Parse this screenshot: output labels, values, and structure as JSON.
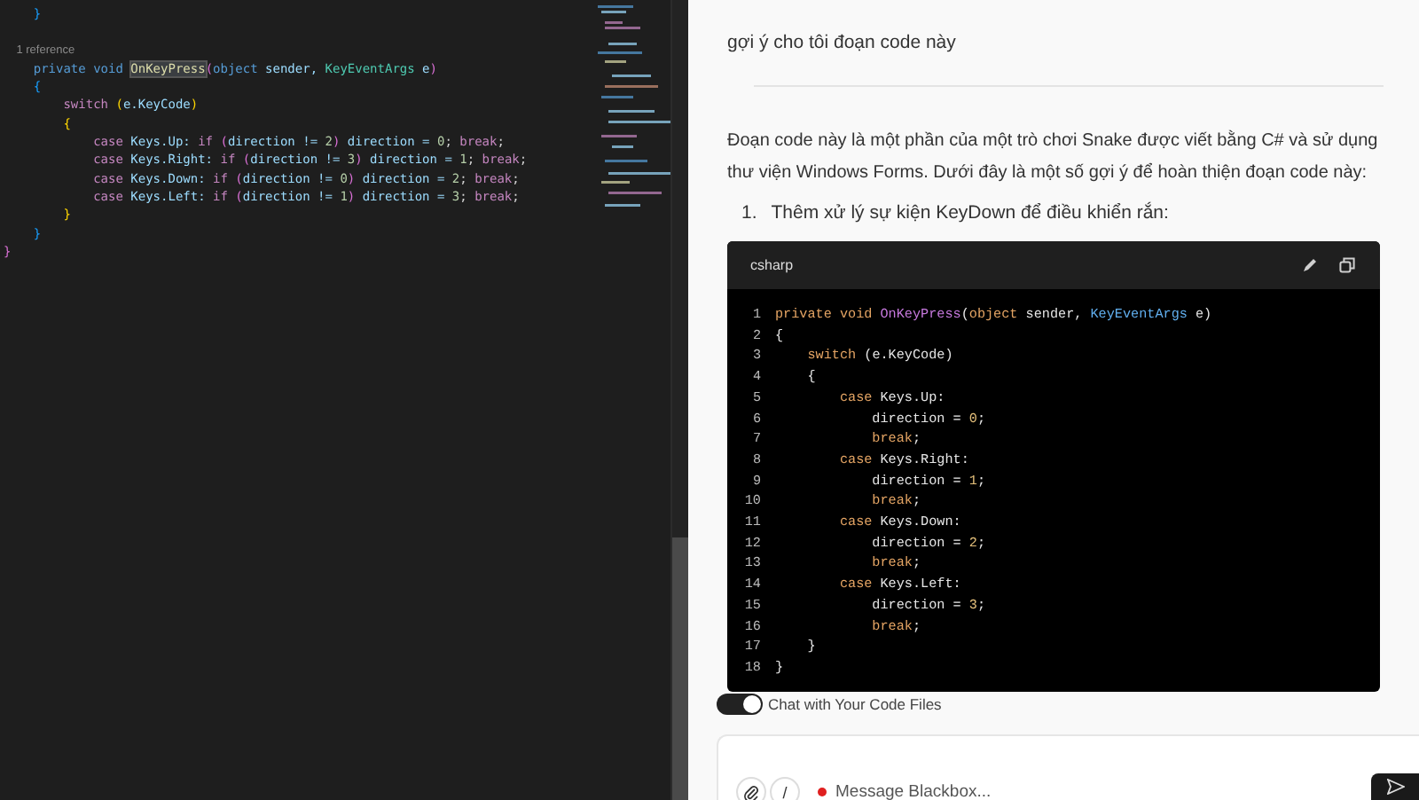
{
  "editor": {
    "lines": [
      {
        "kind": "code",
        "tokens": [
          {
            "text": "    }",
            "kind": "br2"
          }
        ]
      },
      {
        "kind": "lens",
        "tokens": [
          {
            "text": "    1 reference",
            "kind": "lens"
          }
        ]
      },
      {
        "kind": "code",
        "tokens": [
          {
            "text": "    private void ",
            "kind": "kw"
          },
          {
            "text": "OnKeyPress",
            "kind": "fn-hl"
          },
          {
            "text": "(",
            "kind": "br3"
          },
          {
            "text": "object",
            "kind": "kw"
          },
          {
            "text": " sender, ",
            "kind": "var"
          },
          {
            "text": "KeyEventArgs",
            "kind": "type"
          },
          {
            "text": " e",
            "kind": "var"
          },
          {
            "text": ")",
            "kind": "br3"
          }
        ]
      },
      {
        "kind": "code",
        "tokens": [
          {
            "text": "    {",
            "kind": "br2"
          }
        ]
      },
      {
        "kind": "code",
        "tokens": [
          {
            "text": "        switch ",
            "kind": "ctl"
          },
          {
            "text": "(",
            "kind": "br1"
          },
          {
            "text": "e.KeyCode",
            "kind": "var"
          },
          {
            "text": ")",
            "kind": "br1"
          }
        ]
      },
      {
        "kind": "code",
        "tokens": [
          {
            "text": "        {",
            "kind": "br1"
          }
        ]
      },
      {
        "kind": "code",
        "tokens": [
          {
            "text": "            case",
            "kind": "ctl"
          },
          {
            "text": " Keys.Up: ",
            "kind": "var"
          },
          {
            "text": "if ",
            "kind": "ctl"
          },
          {
            "text": "(",
            "kind": "br3"
          },
          {
            "text": "direction != ",
            "kind": "var"
          },
          {
            "text": "2",
            "kind": "num"
          },
          {
            "text": ")",
            "kind": "br3"
          },
          {
            "text": " direction = ",
            "kind": "var"
          },
          {
            "text": "0",
            "kind": "num"
          },
          {
            "text": "; ",
            "kind": "p"
          },
          {
            "text": "break",
            "kind": "ctl"
          },
          {
            "text": ";",
            "kind": "p"
          }
        ]
      },
      {
        "kind": "code",
        "tokens": [
          {
            "text": "            case",
            "kind": "ctl"
          },
          {
            "text": " Keys.Right: ",
            "kind": "var"
          },
          {
            "text": "if ",
            "kind": "ctl"
          },
          {
            "text": "(",
            "kind": "br3"
          },
          {
            "text": "direction != ",
            "kind": "var"
          },
          {
            "text": "3",
            "kind": "num"
          },
          {
            "text": ")",
            "kind": "br3"
          },
          {
            "text": " direction = ",
            "kind": "var"
          },
          {
            "text": "1",
            "kind": "num"
          },
          {
            "text": "; ",
            "kind": "p"
          },
          {
            "text": "break",
            "kind": "ctl"
          },
          {
            "text": ";",
            "kind": "p"
          }
        ]
      },
      {
        "kind": "code",
        "tokens": [
          {
            "text": "            case",
            "kind": "ctl"
          },
          {
            "text": " Keys.Down: ",
            "kind": "var"
          },
          {
            "text": "if ",
            "kind": "ctl"
          },
          {
            "text": "(",
            "kind": "br3"
          },
          {
            "text": "direction != ",
            "kind": "var"
          },
          {
            "text": "0",
            "kind": "num"
          },
          {
            "text": ")",
            "kind": "br3"
          },
          {
            "text": " direction = ",
            "kind": "var"
          },
          {
            "text": "2",
            "kind": "num"
          },
          {
            "text": "; ",
            "kind": "p"
          },
          {
            "text": "break",
            "kind": "ctl"
          },
          {
            "text": ";",
            "kind": "p"
          }
        ]
      },
      {
        "kind": "code",
        "tokens": [
          {
            "text": "            case",
            "kind": "ctl"
          },
          {
            "text": " Keys.Left: ",
            "kind": "var"
          },
          {
            "text": "if ",
            "kind": "ctl"
          },
          {
            "text": "(",
            "kind": "br3"
          },
          {
            "text": "direction != ",
            "kind": "var"
          },
          {
            "text": "1",
            "kind": "num"
          },
          {
            "text": ")",
            "kind": "br3"
          },
          {
            "text": " direction = ",
            "kind": "var"
          },
          {
            "text": "3",
            "kind": "num"
          },
          {
            "text": "; ",
            "kind": "p"
          },
          {
            "text": "break",
            "kind": "ctl"
          },
          {
            "text": ";",
            "kind": "p"
          }
        ]
      },
      {
        "kind": "code",
        "tokens": [
          {
            "text": "        }",
            "kind": "br1"
          }
        ]
      },
      {
        "kind": "code",
        "tokens": [
          {
            "text": "    }",
            "kind": "br2"
          }
        ]
      },
      {
        "kind": "code",
        "tokens": [
          {
            "text": "}",
            "kind": "br3"
          }
        ]
      }
    ]
  },
  "chat": {
    "user_message": "gợi ý cho tôi đoạn code này",
    "answer_paragraph": "Đoạn code này là một phần của một trò chơi Snake được viết bằng C# và sử dụng thư viện Windows Forms. Dưới đây là một số gợi ý để hoàn thiện đoạn code này:",
    "list_items": [
      {
        "number": "1.",
        "text": "Thêm xử lý sự kiện KeyDown để điều khiển rắn:"
      }
    ],
    "code_block": {
      "language": "csharp",
      "lines": [
        {
          "n": "1",
          "tokens": [
            {
              "text": "private void ",
              "kind": "kw"
            },
            {
              "text": "OnKeyPress",
              "kind": "fn"
            },
            {
              "text": "(",
              "kind": "p"
            },
            {
              "text": "object",
              "kind": "kw"
            },
            {
              "text": " sender, ",
              "kind": "p"
            },
            {
              "text": "KeyEventArgs",
              "kind": "type"
            },
            {
              "text": " e)",
              "kind": "p"
            }
          ]
        },
        {
          "n": "2",
          "tokens": [
            {
              "text": "{",
              "kind": "p"
            }
          ]
        },
        {
          "n": "3",
          "tokens": [
            {
              "text": "    switch",
              "kind": "kw"
            },
            {
              "text": " (e.KeyCode)",
              "kind": "p"
            }
          ]
        },
        {
          "n": "4",
          "tokens": [
            {
              "text": "    {",
              "kind": "p"
            }
          ]
        },
        {
          "n": "5",
          "tokens": [
            {
              "text": "        case",
              "kind": "kw"
            },
            {
              "text": " Keys.Up:",
              "kind": "p"
            }
          ]
        },
        {
          "n": "6",
          "tokens": [
            {
              "text": "            direction = ",
              "kind": "p"
            },
            {
              "text": "0",
              "kind": "num"
            },
            {
              "text": ";",
              "kind": "p"
            }
          ]
        },
        {
          "n": "7",
          "tokens": [
            {
              "text": "            break",
              "kind": "kw"
            },
            {
              "text": ";",
              "kind": "p"
            }
          ]
        },
        {
          "n": "8",
          "tokens": [
            {
              "text": "        case",
              "kind": "kw"
            },
            {
              "text": " Keys.Right:",
              "kind": "p"
            }
          ]
        },
        {
          "n": "9",
          "tokens": [
            {
              "text": "            direction = ",
              "kind": "p"
            },
            {
              "text": "1",
              "kind": "num"
            },
            {
              "text": ";",
              "kind": "p"
            }
          ]
        },
        {
          "n": "10",
          "tokens": [
            {
              "text": "            break",
              "kind": "kw"
            },
            {
              "text": ";",
              "kind": "p"
            }
          ]
        },
        {
          "n": "11",
          "tokens": [
            {
              "text": "        case",
              "kind": "kw"
            },
            {
              "text": " Keys.Down:",
              "kind": "p"
            }
          ]
        },
        {
          "n": "12",
          "tokens": [
            {
              "text": "            direction = ",
              "kind": "p"
            },
            {
              "text": "2",
              "kind": "num"
            },
            {
              "text": ";",
              "kind": "p"
            }
          ]
        },
        {
          "n": "13",
          "tokens": [
            {
              "text": "            break",
              "kind": "kw"
            },
            {
              "text": ";",
              "kind": "p"
            }
          ]
        },
        {
          "n": "14",
          "tokens": [
            {
              "text": "        case",
              "kind": "kw"
            },
            {
              "text": " Keys.Left:",
              "kind": "p"
            }
          ]
        },
        {
          "n": "15",
          "tokens": [
            {
              "text": "            direction = ",
              "kind": "p"
            },
            {
              "text": "3",
              "kind": "num"
            },
            {
              "text": ";",
              "kind": "p"
            }
          ]
        },
        {
          "n": "16",
          "tokens": [
            {
              "text": "            break",
              "kind": "kw"
            },
            {
              "text": ";",
              "kind": "p"
            }
          ]
        },
        {
          "n": "17",
          "tokens": [
            {
              "text": "    }",
              "kind": "p"
            }
          ]
        },
        {
          "n": "18",
          "tokens": [
            {
              "text": "}",
              "kind": "p"
            }
          ]
        }
      ]
    },
    "toggle": {
      "label": "Chat with Your Code Files",
      "on": true
    },
    "composer": {
      "placeholder": "Message Blackbox...",
      "slash": "/"
    }
  }
}
